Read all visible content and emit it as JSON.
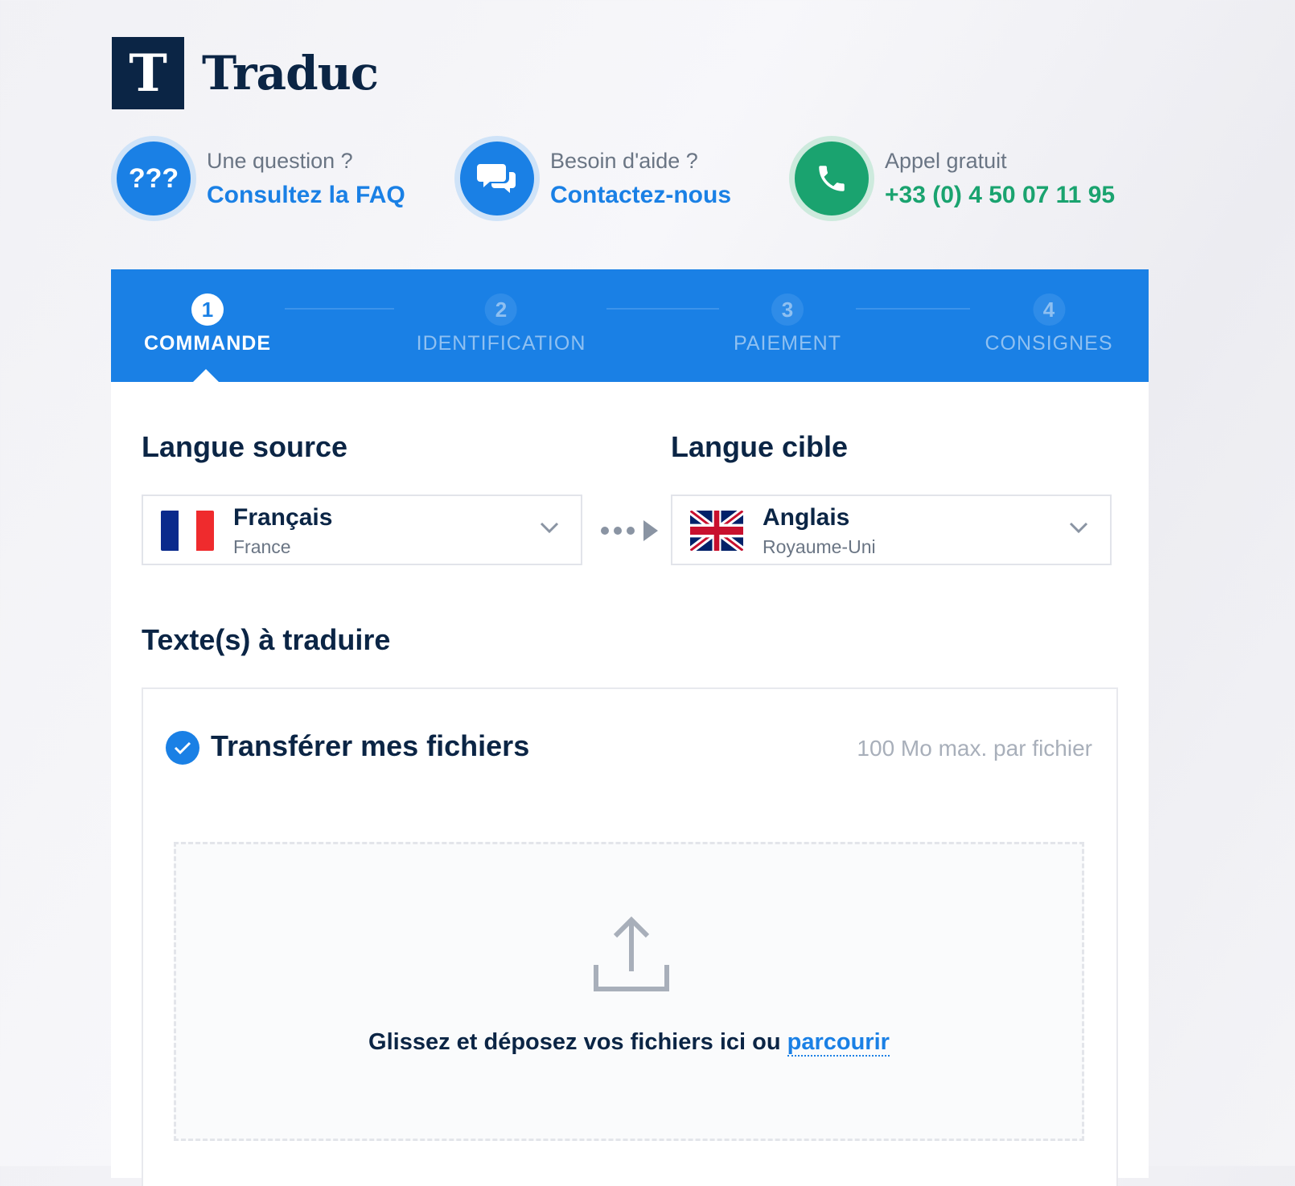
{
  "brand": {
    "logo_letter": "T",
    "name": "Traduc"
  },
  "contacts": [
    {
      "question": "Une question ?",
      "action": "Consultez la FAQ",
      "icon": "question-marks-icon"
    },
    {
      "question": "Besoin d'aide ?",
      "action": "Contactez-nous",
      "icon": "chat-bubbles-icon"
    },
    {
      "question": "Appel gratuit",
      "action": "+33 (0) 4 50 07 11 95",
      "icon": "phone-icon"
    }
  ],
  "faq_icon_text": "???",
  "steps": [
    {
      "number": "1",
      "label": "COMMANDE",
      "active": true
    },
    {
      "number": "2",
      "label": "IDENTIFICATION",
      "active": false
    },
    {
      "number": "3",
      "label": "PAIEMENT",
      "active": false
    },
    {
      "number": "4",
      "label": "CONSIGNES",
      "active": false
    }
  ],
  "source": {
    "title": "Langue source",
    "language": "Français",
    "country": "France",
    "flag_icon": "france-flag-icon"
  },
  "target": {
    "title": "Langue cible",
    "language": "Anglais",
    "country": "Royaume-Uni",
    "flag_icon": "uk-flag-icon"
  },
  "texts": {
    "title": "Texte(s) à traduire",
    "option_label": "Transférer mes fichiers",
    "max_size": "100 Mo max. par fichier",
    "drop_text": "Glissez et déposez vos fichiers ici ou",
    "browse_link": "parcourir"
  },
  "colors": {
    "primary": "#1a80e5",
    "navy": "#0b2545",
    "green": "#1aa36f"
  }
}
